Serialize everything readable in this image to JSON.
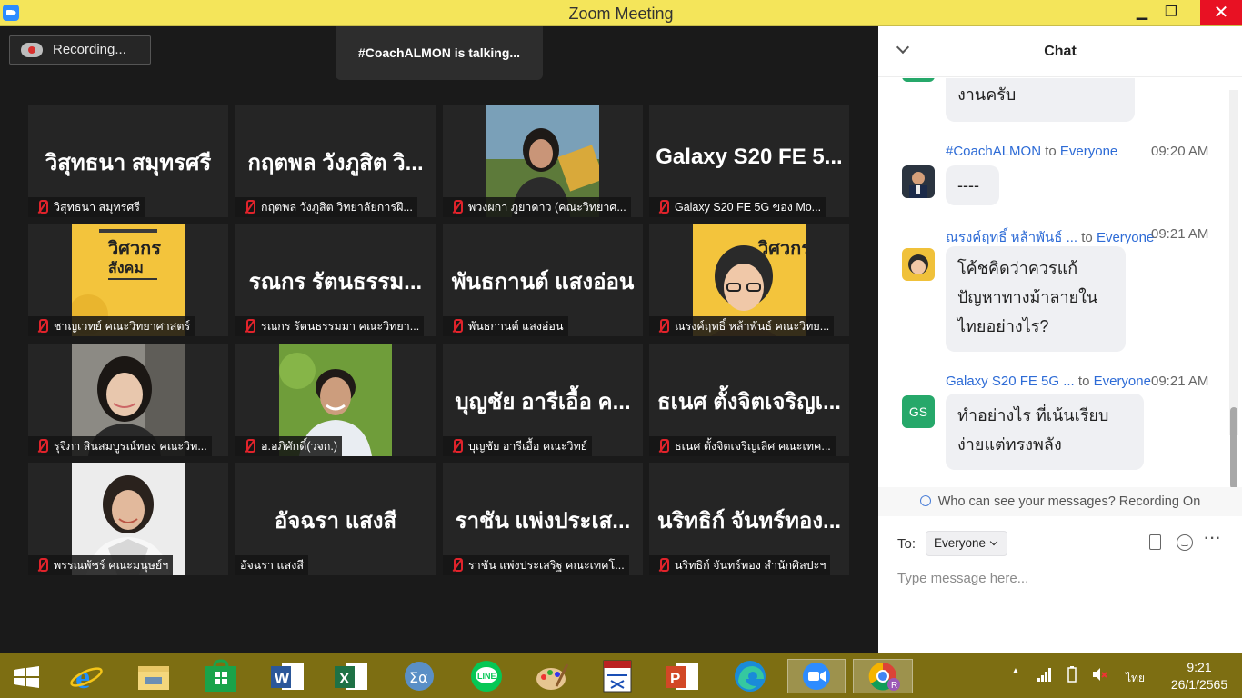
{
  "window": {
    "title": "Zoom Meeting",
    "minimize": "▁",
    "maximize": "❐",
    "close": "✕"
  },
  "meeting": {
    "recording_label": "Recording...",
    "talking_label": "#CoachALMON is talking..."
  },
  "tiles": [
    {
      "big": "วิสุทธนา สมุทรศรี",
      "caption": "วิสุทธนา สมุทรศรี",
      "muted": true,
      "photo": null
    },
    {
      "big": "กฤตพล วังภูสิต วิ...",
      "caption": "กฤตพล วังภูสิต วิทยาลัยการฝึ...",
      "muted": true,
      "photo": null
    },
    {
      "big": "",
      "caption": "พวงผกา ภูยาดาว (คณะวิทยาศ...",
      "muted": true,
      "photo": "woman-outdoor"
    },
    {
      "big": "Galaxy S20 FE 5...",
      "caption": "Galaxy S20 FE 5G ของ Mo...",
      "muted": true,
      "photo": null
    },
    {
      "big": "",
      "caption": "ชาญเวทย์ คณะวิทยาศาสตร์",
      "muted": true,
      "photo": "yellow-poster"
    },
    {
      "big": "รณกร รัตนธรรม...",
      "caption": "รณกร รัตนธรรมมา คณะวิทยา...",
      "muted": true,
      "photo": null
    },
    {
      "big": "พันธกานต์ แสงอ่อน",
      "caption": "พันธกานต์ แสงอ่อน",
      "muted": true,
      "photo": null
    },
    {
      "big": "",
      "caption": "ณรงค์ฤทธิ์ หล้าพันธ์ คณะวิทย...",
      "muted": true,
      "photo": "avatar-poster"
    },
    {
      "big": "",
      "caption": "รุจิภา สินสมบูรณ์ทอง คณะวิท...",
      "muted": true,
      "photo": "woman-indoor"
    },
    {
      "big": "",
      "caption": "อ.อภิศักดิ์(วจก.)",
      "muted": true,
      "photo": "man-green"
    },
    {
      "big": "บุญชัย อารีเอื้อ ค...",
      "caption": "บุญชัย อารีเอื้อ คณะวิทย์",
      "muted": true,
      "photo": null
    },
    {
      "big": "ธเนศ ตั้งจิตเจริญเ...",
      "caption": "ธเนศ ตั้งจิตเจริญเลิศ คณะเทค...",
      "muted": true,
      "photo": null
    },
    {
      "big": "",
      "caption": "พรรณพัชร์ คณะมนุษย์ฯ",
      "muted": true,
      "photo": "woman-white"
    },
    {
      "big": "อัจฉรา แสงสี",
      "caption": "อัจฉรา แสงสี",
      "muted": false,
      "photo": null
    },
    {
      "big": "ราชัน แพ่งประเส...",
      "caption": "ราชัน แพ่งประเสริฐ คณะเทคโ...",
      "muted": true,
      "photo": null
    },
    {
      "big": "นริทธิก์ จันทร์ทอง...",
      "caption": "นริทธิก์ จันทร์ทอง สำนักศิลปะฯ",
      "muted": true,
      "photo": null
    }
  ],
  "poster_text": {
    "line1": "วิศวกร",
    "line2": "สังคม"
  },
  "chat": {
    "title": "Chat",
    "messages": [
      {
        "sender": "",
        "to": "",
        "recipient": "",
        "time": "",
        "text": "งานครับ",
        "avatar": "none"
      },
      {
        "sender": "#CoachALMON",
        "to": "to",
        "recipient": "Everyone",
        "time": "09:20 AM",
        "text": "----",
        "avatar": "photo-man"
      },
      {
        "sender": "ณรงค์ฤทธิ์ หล้าพันธ์ ...",
        "to": "to",
        "recipient": "Everyone",
        "time": "09:21 AM",
        "text": "โค้ชคิดว่าควรแก้ปัญหาทางม้าลายในไทยอย่างไร?",
        "avatar": "photo-avatar"
      },
      {
        "sender": "Galaxy S20 FE 5G ...",
        "to": "to",
        "recipient": "Everyone",
        "time": "09:21 AM",
        "text": "ทำอย่างไร ที่เน้นเรียบง่ายแต่ทรงพลัง",
        "avatar": "initials",
        "initials": "GS"
      }
    ],
    "privacy_notice": "Who can see your messages? Recording On",
    "to_label": "To:",
    "to_value": "Everyone",
    "input_placeholder": "Type message here...",
    "more_label": "···"
  },
  "taskbar": {
    "apps": [
      "windows-start",
      "internet-explorer",
      "file-explorer",
      "windows-store",
      "word",
      "excel",
      "math-input",
      "line",
      "paint",
      "lisrel",
      "powerpoint",
      "edge",
      "zoom",
      "chrome"
    ],
    "language": "ไทย",
    "time": "9:21",
    "date": "26/1/2565"
  },
  "colors": {
    "titlebar": "#f4e55a",
    "taskbar": "#7d6e12",
    "accent": "#2d6bd6",
    "mute": "#e0232b"
  }
}
